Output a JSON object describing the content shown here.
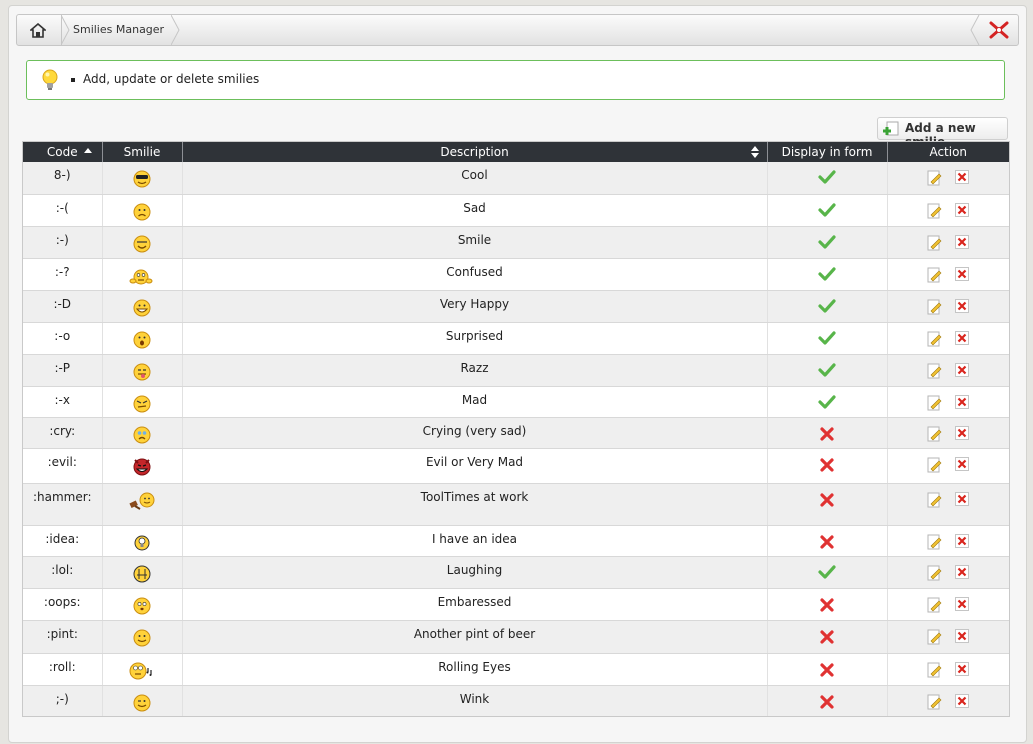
{
  "breadcrumb": {
    "title": "Smilies Manager"
  },
  "info": {
    "text": "Add, update or delete smilies"
  },
  "toolbar": {
    "add_label": "Add a new smilie"
  },
  "table": {
    "headers": {
      "code": "Code",
      "smilie": "Smilie",
      "description": "Description",
      "display": "Display in form",
      "action": "Action"
    },
    "rows": [
      {
        "code": "8-)",
        "description": "Cool",
        "display": true,
        "smilie_icon": "cool-smilie-icon"
      },
      {
        "code": ":-(",
        "description": "Sad",
        "display": true,
        "smilie_icon": "sad-smilie-icon"
      },
      {
        "code": ":-)",
        "description": "Smile",
        "display": true,
        "smilie_icon": "smile-smilie-icon"
      },
      {
        "code": ":-?",
        "description": "Confused",
        "display": true,
        "smilie_icon": "confused-smilie-icon"
      },
      {
        "code": ":-D",
        "description": "Very Happy",
        "display": true,
        "smilie_icon": "very-happy-smilie-icon"
      },
      {
        "code": ":-o",
        "description": "Surprised",
        "display": true,
        "smilie_icon": "surprised-smilie-icon"
      },
      {
        "code": ":-P",
        "description": "Razz",
        "display": true,
        "smilie_icon": "razz-smilie-icon"
      },
      {
        "code": ":-x",
        "description": "Mad",
        "display": true,
        "smilie_icon": "mad-smilie-icon"
      },
      {
        "code": ":cry:",
        "description": "Crying (very sad)",
        "display": false,
        "smilie_icon": "crying-smilie-icon"
      },
      {
        "code": ":evil:",
        "description": "Evil or Very Mad",
        "display": false,
        "smilie_icon": "evil-smilie-icon"
      },
      {
        "code": ":hammer:",
        "description": "ToolTimes at work",
        "display": false,
        "smilie_icon": "hammer-smilie-icon"
      },
      {
        "code": ":idea:",
        "description": "I have an idea",
        "display": false,
        "smilie_icon": "idea-smilie-icon"
      },
      {
        "code": ":lol:",
        "description": "Laughing",
        "display": true,
        "smilie_icon": "laughing-smilie-icon"
      },
      {
        "code": ":oops:",
        "description": "Embaressed",
        "display": false,
        "smilie_icon": "embarrassed-smilie-icon"
      },
      {
        "code": ":pint:",
        "description": "Another pint of beer",
        "display": false,
        "smilie_icon": "pint-smilie-icon"
      },
      {
        "code": ":roll:",
        "description": "Rolling Eyes",
        "display": false,
        "smilie_icon": "rolling-eyes-smilie-icon"
      },
      {
        "code": ";-)",
        "description": "Wink",
        "display": false,
        "smilie_icon": "wink-smilie-icon"
      }
    ]
  },
  "colors": {
    "header_bg": "#2f3338",
    "info_border": "#6cbf5b",
    "check_green": "#58b54a",
    "cross_red": "#e03232"
  }
}
